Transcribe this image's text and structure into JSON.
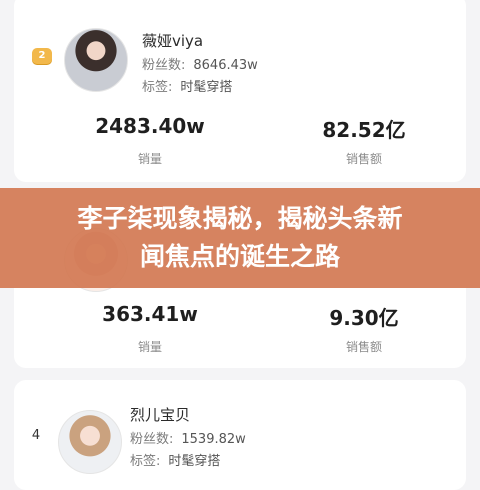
{
  "card1": {
    "rank": "2",
    "name": "薇娅viya",
    "fans_label": "粉丝数:",
    "fans_value": "8646.43w",
    "tags_label": "标签:",
    "tags_value": "时髦穿搭",
    "sales_value": "2483.40w",
    "sales_label": "销量",
    "revenue_value": "82.52亿",
    "revenue_label": "销售额"
  },
  "card2": {
    "sales_value": "363.41w",
    "sales_label": "销量",
    "revenue_value": "9.30亿",
    "revenue_label": "销售额"
  },
  "card3": {
    "rank": "4",
    "name": "烈儿宝贝",
    "fans_label": "粉丝数:",
    "fans_value": "1539.82w",
    "tags_label": "标签:",
    "tags_value": "时髦穿搭"
  },
  "banner": {
    "line1": "李子柒现象揭秘，揭秘头条新",
    "line2": "闻焦点的诞生之路"
  },
  "colors": {
    "banner": "#d37853",
    "badge": "#f2b84b"
  }
}
